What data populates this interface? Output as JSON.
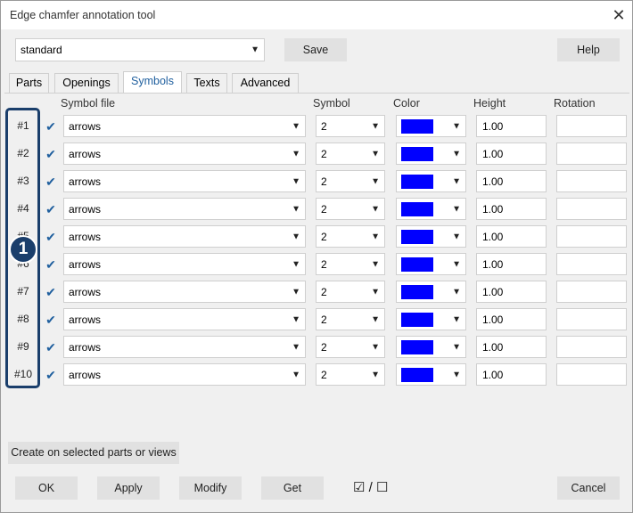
{
  "window": {
    "title": "Edge chamfer annotation tool",
    "close_icon": "close-icon"
  },
  "toolbar": {
    "preset_value": "standard",
    "save_label": "Save",
    "help_label": "Help"
  },
  "tabs": [
    {
      "label": "Parts",
      "active": false
    },
    {
      "label": "Openings",
      "active": false
    },
    {
      "label": "Symbols",
      "active": true
    },
    {
      "label": "Texts",
      "active": false
    },
    {
      "label": "Advanced",
      "active": false
    }
  ],
  "columns": {
    "symbol_file": "Symbol file",
    "symbol": "Symbol",
    "color": "Color",
    "height": "Height",
    "rotation": "Rotation"
  },
  "rows": [
    {
      "label": "#1",
      "checked": true,
      "symbol_file": "arrows",
      "symbol": "2",
      "color": "#0000ff",
      "height": "1.00",
      "rotation": ""
    },
    {
      "label": "#2",
      "checked": true,
      "symbol_file": "arrows",
      "symbol": "2",
      "color": "#0000ff",
      "height": "1.00",
      "rotation": ""
    },
    {
      "label": "#3",
      "checked": true,
      "symbol_file": "arrows",
      "symbol": "2",
      "color": "#0000ff",
      "height": "1.00",
      "rotation": ""
    },
    {
      "label": "#4",
      "checked": true,
      "symbol_file": "arrows",
      "symbol": "2",
      "color": "#0000ff",
      "height": "1.00",
      "rotation": ""
    },
    {
      "label": "#5",
      "checked": true,
      "symbol_file": "arrows",
      "symbol": "2",
      "color": "#0000ff",
      "height": "1.00",
      "rotation": ""
    },
    {
      "label": "#6",
      "checked": true,
      "symbol_file": "arrows",
      "symbol": "2",
      "color": "#0000ff",
      "height": "1.00",
      "rotation": ""
    },
    {
      "label": "#7",
      "checked": true,
      "symbol_file": "arrows",
      "symbol": "2",
      "color": "#0000ff",
      "height": "1.00",
      "rotation": ""
    },
    {
      "label": "#8",
      "checked": true,
      "symbol_file": "arrows",
      "symbol": "2",
      "color": "#0000ff",
      "height": "1.00",
      "rotation": ""
    },
    {
      "label": "#9",
      "checked": true,
      "symbol_file": "arrows",
      "symbol": "2",
      "color": "#0000ff",
      "height": "1.00",
      "rotation": ""
    },
    {
      "label": "#10",
      "checked": true,
      "symbol_file": "arrows",
      "symbol": "2",
      "color": "#0000ff",
      "height": "1.00",
      "rotation": ""
    }
  ],
  "callout": {
    "number": "1",
    "color": "#1a3e6b"
  },
  "actions": {
    "create_label": "Create on selected parts or views",
    "ok_label": "OK",
    "apply_label": "Apply",
    "modify_label": "Modify",
    "get_label": "Get",
    "cancel_label": "Cancel",
    "toggle_text": "☑ / ☐"
  }
}
